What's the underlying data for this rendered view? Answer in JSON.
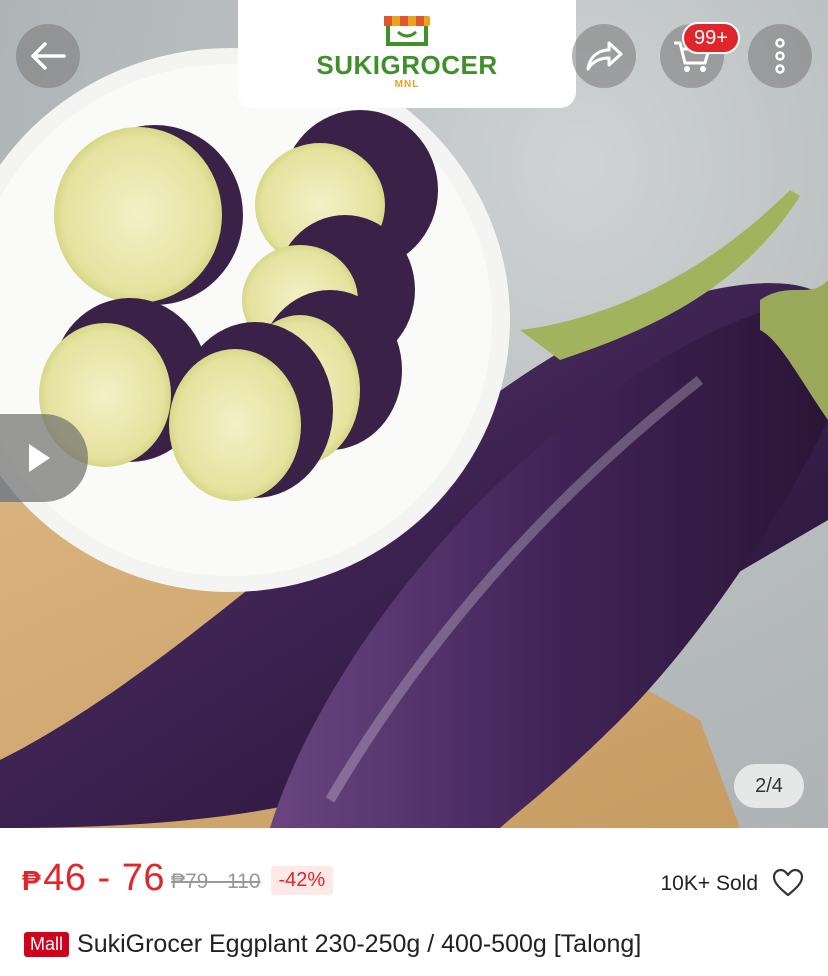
{
  "header": {
    "back_icon": "arrow-left-icon",
    "share_icon": "share-icon",
    "cart_icon": "cart-icon",
    "cart_badge": "99+",
    "more_icon": "more-vertical-icon"
  },
  "store_logo": {
    "name": "SUKIGROCER",
    "sub": "MNL"
  },
  "gallery": {
    "play_icon": "play-icon",
    "counter": "2/4"
  },
  "product": {
    "price_currency": "₱",
    "price_range": "46 - 76",
    "original_price": "₱79 - 110",
    "discount": "-42%",
    "sold": "10K+ Sold",
    "favorite_icon": "heart-outline-icon",
    "mall_badge": "Mall",
    "title": "SukiGrocer Eggplant 230-250g / 400-500g [Talong]"
  },
  "colors": {
    "accent": "#e0262b",
    "brand_green": "#3f8f2a"
  }
}
